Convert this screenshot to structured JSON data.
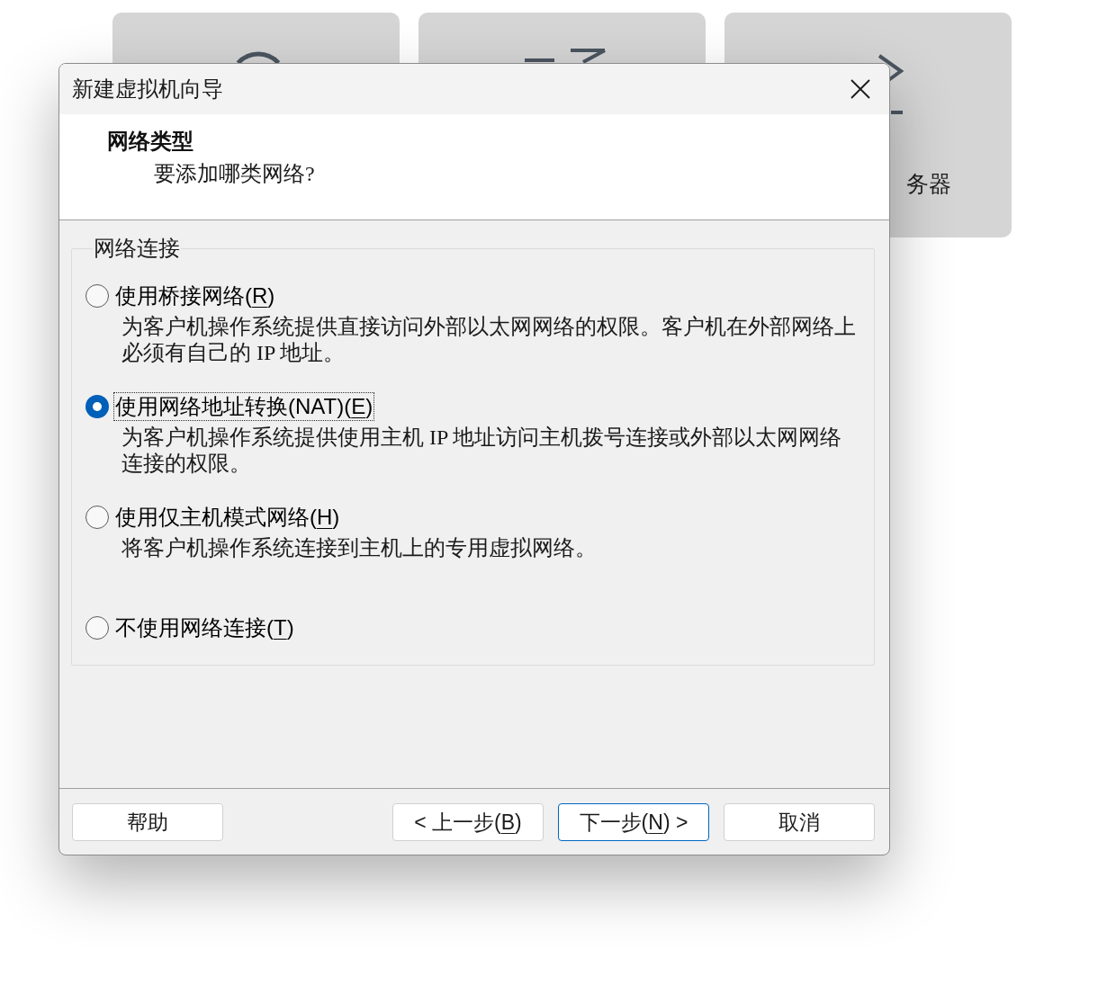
{
  "background": {
    "card_label": "务器"
  },
  "window": {
    "title": "新建虚拟机向导"
  },
  "header": {
    "title": "网络类型",
    "subtitle": "要添加哪类网络?"
  },
  "network_group": {
    "legend": "网络连接",
    "options": [
      {
        "label": "使用桥接网络(",
        "mnemonic": "R",
        "label_end": ")",
        "description": "为客户机操作系统提供直接访问外部以太网网络的权限。客户机在外部网络上必须有自己的 IP 地址。",
        "selected": false,
        "focused": false
      },
      {
        "label": "使用网络地址转换(NAT)(",
        "mnemonic": "E",
        "label_end": ")",
        "description": "为客户机操作系统提供使用主机 IP 地址访问主机拨号连接或外部以太网网络连接的权限。",
        "selected": true,
        "focused": true
      },
      {
        "label": "使用仅主机模式网络(",
        "mnemonic": "H",
        "label_end": ")",
        "description": "将客户机操作系统连接到主机上的专用虚拟网络。",
        "selected": false,
        "focused": false
      },
      {
        "label": "不使用网络连接(",
        "mnemonic": "T",
        "label_end": ")",
        "selected": false,
        "focused": false
      }
    ]
  },
  "buttons": [
    {
      "label": "帮助",
      "default": false
    },
    {
      "label": "< 上一步(",
      "mnemonic": "B",
      "label_end": ")",
      "default": false
    },
    {
      "label": "下一步(",
      "mnemonic": "N",
      "label_end": ") >",
      "default": true
    },
    {
      "label": "取消",
      "default": false
    }
  ]
}
